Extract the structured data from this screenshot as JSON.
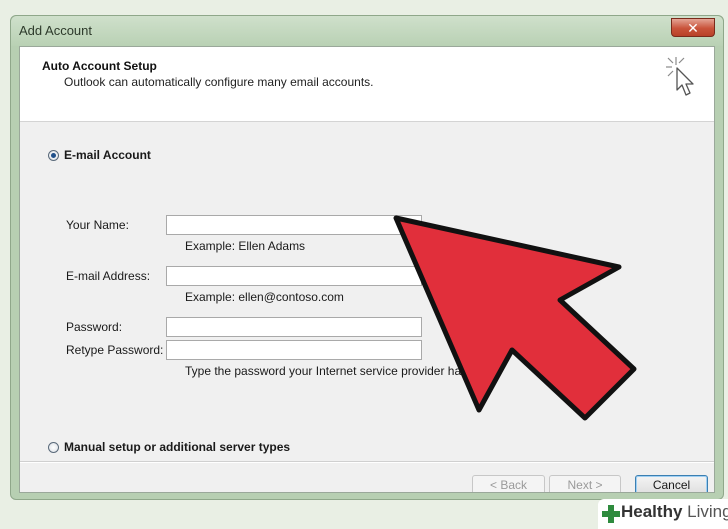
{
  "window": {
    "title": "Add Account",
    "close_glyph": "✕"
  },
  "header": {
    "title": "Auto Account Setup",
    "subtitle": "Outlook can automatically configure many email accounts.",
    "icon": "cursor-sparkle-icon"
  },
  "options": {
    "email_account": {
      "label": "E-mail Account",
      "checked": true
    },
    "manual_setup": {
      "label": "Manual setup or additional server types",
      "checked": false
    }
  },
  "form": {
    "your_name": {
      "label": "Your Name:",
      "value": "",
      "hint": "Example: Ellen Adams"
    },
    "email_address": {
      "label": "E-mail Address:",
      "value": "",
      "hint": "Example: ellen@contoso.com"
    },
    "password": {
      "label": "Password:",
      "value": ""
    },
    "retype_password": {
      "label": "Retype Password:",
      "value": ""
    },
    "password_hint": "Type the password your Internet service provider has giv"
  },
  "buttons": {
    "back": "< Back",
    "next": "Next >",
    "cancel": "Cancel"
  },
  "overlay": {
    "arrow_color": "#e12f3b",
    "arrow_outline": "#111111"
  },
  "watermark": {
    "brand_bold": "Healthy",
    "brand_light": " Living",
    "cross_color": "#2e8b3e"
  }
}
